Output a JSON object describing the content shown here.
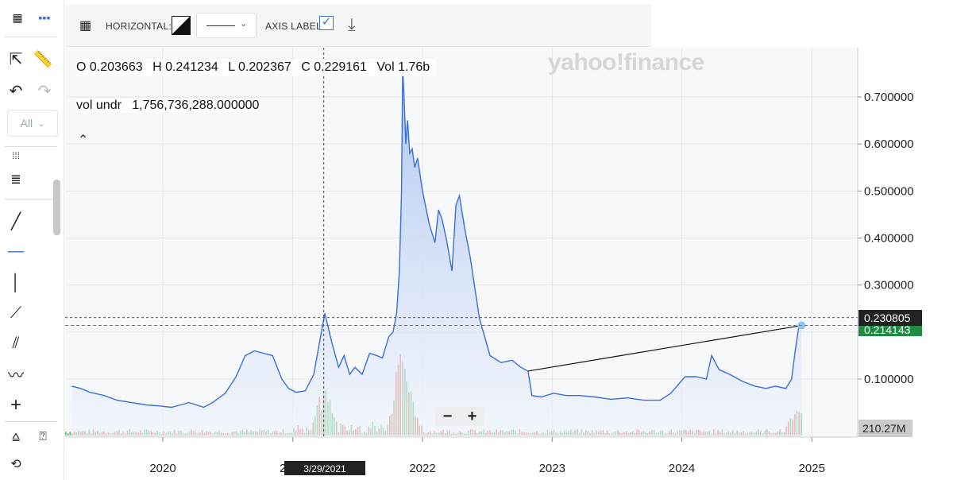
{
  "toolbar": {
    "horizontal_label": "HORIZONTAL:",
    "axis_label_label": "AXIS LABEL:",
    "axis_label_checked": true,
    "range_select": "All"
  },
  "ohlc": {
    "open": "O 0.203663",
    "high": "H 0.241234",
    "low": "L 0.202367",
    "close": "C 0.229161",
    "volume": "Vol 1.76b"
  },
  "vol_undr": "vol undr",
  "vol_undr_value": "1,756,736,288.000000",
  "watermark": "yahoo!finance",
  "crosshair_date": "3/29/2021",
  "price_tags": {
    "crosshair": "0.230805",
    "last": "0.214143",
    "volume": "210.27M"
  },
  "zoom": {
    "minus": "−",
    "plus": "+"
  },
  "colors": {
    "line": "#3a6fd8",
    "area_top": "#a9c2ef",
    "area_bottom": "#eef3fc",
    "vol_up": "#5cbf6b",
    "vol_down": "#e06a5a",
    "last_tag": "#1f8a42",
    "crosshair_tag": "#222222"
  },
  "chart_data": {
    "type": "area",
    "xlabel": "",
    "ylabel": "",
    "ylim": [
      0.0,
      0.79
    ],
    "x_ticks": [
      "2020",
      "2021",
      "2022",
      "2023",
      "2024",
      "2025"
    ],
    "y_ticks": [
      "0.100000",
      "0.300000",
      "0.400000",
      "0.500000",
      "0.600000",
      "0.700000"
    ],
    "grid": true,
    "trendline": {
      "from": [
        "2022-10-25",
        0.117
      ],
      "to": [
        "2024-12-03",
        0.214
      ]
    },
    "horizontal_lines": [
      0.230805,
      0.214143
    ],
    "series": [
      {
        "x": [
          "2019-04-20",
          "2019-05-15",
          "2019-06-10",
          "2019-07-20",
          "2019-08-25",
          "2019-10-05",
          "2019-11-15",
          "2019-12-20",
          "2020-01-25",
          "2020-02-20",
          "2020-03-15",
          "2020-04-25",
          "2020-05-20",
          "2020-06-25",
          "2020-07-25",
          "2020-08-20",
          "2020-09-15",
          "2020-10-10",
          "2020-11-05",
          "2020-12-01",
          "2020-12-20",
          "2021-01-10",
          "2021-02-05",
          "2021-03-01",
          "2021-03-20",
          "2021-04-01",
          "2021-04-20",
          "2021-05-10",
          "2021-05-25",
          "2021-06-10",
          "2021-06-25",
          "2021-07-15",
          "2021-08-05",
          "2021-08-25",
          "2021-09-10",
          "2021-09-28",
          "2021-10-10",
          "2021-10-20",
          "2021-10-28",
          "2021-11-03",
          "2021-11-06",
          "2021-11-10",
          "2021-11-15",
          "2021-11-20",
          "2021-11-26",
          "2021-12-03",
          "2021-12-10",
          "2021-12-18",
          "2022-01-01",
          "2022-01-20",
          "2022-02-05",
          "2022-02-15",
          "2022-02-25",
          "2022-03-10",
          "2022-03-25",
          "2022-04-05",
          "2022-04-15",
          "2022-04-30",
          "2022-05-15",
          "2022-06-10",
          "2022-07-10",
          "2022-08-10",
          "2022-09-10",
          "2022-10-05",
          "2022-10-25",
          "2022-11-05",
          "2022-12-01",
          "2023-01-05",
          "2023-02-10",
          "2023-03-20",
          "2023-05-01",
          "2023-06-15",
          "2023-08-01",
          "2023-09-15",
          "2023-11-01",
          "2023-12-01",
          "2024-01-10",
          "2024-02-10",
          "2024-03-10",
          "2024-03-25",
          "2024-04-15",
          "2024-05-15",
          "2024-06-20",
          "2024-07-25",
          "2024-08-25",
          "2024-09-20",
          "2024-10-20",
          "2024-11-05",
          "2024-11-15",
          "2024-11-25",
          "2024-12-03"
        ],
        "y": [
          0.085,
          0.08,
          0.072,
          0.065,
          0.055,
          0.05,
          0.045,
          0.043,
          0.04,
          0.045,
          0.05,
          0.04,
          0.05,
          0.07,
          0.105,
          0.15,
          0.16,
          0.155,
          0.15,
          0.1,
          0.08,
          0.072,
          0.075,
          0.11,
          0.19,
          0.24,
          0.18,
          0.125,
          0.15,
          0.11,
          0.125,
          0.11,
          0.155,
          0.15,
          0.145,
          0.19,
          0.2,
          0.24,
          0.33,
          0.5,
          0.76,
          0.7,
          0.6,
          0.65,
          0.58,
          0.59,
          0.55,
          0.57,
          0.5,
          0.43,
          0.39,
          0.46,
          0.44,
          0.395,
          0.33,
          0.47,
          0.49,
          0.42,
          0.36,
          0.23,
          0.15,
          0.135,
          0.14,
          0.125,
          0.117,
          0.065,
          0.062,
          0.07,
          0.065,
          0.065,
          0.062,
          0.057,
          0.06,
          0.055,
          0.055,
          0.07,
          0.105,
          0.105,
          0.1,
          0.15,
          0.12,
          0.11,
          0.095,
          0.085,
          0.08,
          0.085,
          0.08,
          0.1,
          0.16,
          0.21,
          0.214
        ]
      }
    ],
    "volume": {
      "x_range": [
        "2019-04-01",
        "2024-12-05"
      ],
      "spikes": [
        {
          "x": "2021-03-29",
          "v": 0.6
        },
        {
          "x": "2021-11-10",
          "v": 0.9
        },
        {
          "x": "2021-10-25",
          "v": 0.55
        },
        {
          "x": "2024-11-20",
          "v": 0.35
        }
      ]
    }
  }
}
